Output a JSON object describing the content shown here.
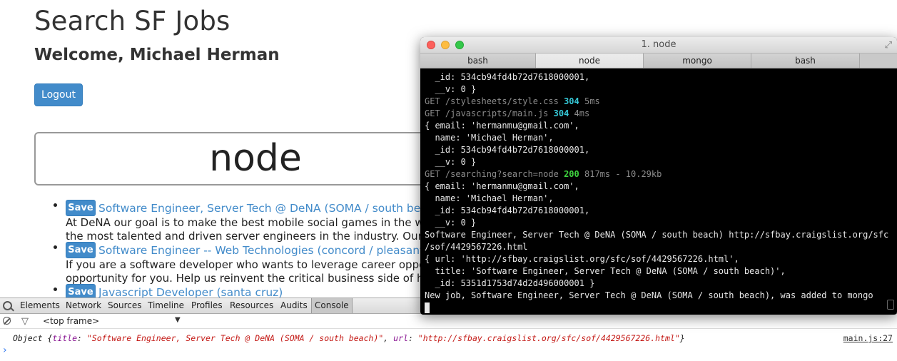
{
  "page": {
    "title": "Search SF Jobs",
    "welcome": "Welcome, Michael Herman",
    "logout_label": "Logout",
    "search_value": "node"
  },
  "jobs": [
    {
      "save_label": "Save",
      "title": "Software Engineer, Server Tech @ DeNA (SOMA / south beach)",
      "desc": [
        "At DeNA our goal is to make the best mobile social games in the wo",
        "the most talented and driven server engineers in the industry. Our s"
      ]
    },
    {
      "save_label": "Save",
      "title": "Software Engineer -- Web Technologies (concord / pleasant h",
      "desc": [
        "If you are a software developer who wants to leverage career opport",
        "opportunity for you. Help us reinvent the critical business side of he"
      ]
    },
    {
      "save_label": "Save",
      "title": "Javascript Developer (santa cruz)",
      "desc": []
    }
  ],
  "devtools": {
    "tabs": [
      "Elements",
      "Network",
      "Sources",
      "Timeline",
      "Profiles",
      "Resources",
      "Audits",
      "Console"
    ],
    "active_tab": "Console",
    "frame": "<top frame>",
    "console": {
      "prefix": "Object {",
      "title_key": "title",
      "title_value": "\"Software Engineer, Server Tech @ DeNA (SOMA / south beach)\"",
      "url_key": "url",
      "url_value": "\"http://sfbay.craigslist.org/sfc/sof/4429567226.html\"",
      "suffix": "}",
      "source": "main.js:27"
    },
    "prompt": "›"
  },
  "terminal": {
    "title": "1. node",
    "tabs": [
      "bash",
      "node",
      "mongo",
      "bash"
    ],
    "active_tab": "node",
    "lines": [
      [
        {
          "t": "  _id: 534cb94fd4b72d7618000001,"
        }
      ],
      [
        {
          "t": "  __v: 0 }"
        }
      ],
      [
        {
          "t": "GET /stylesheets/style.css ",
          "c": "dim"
        },
        {
          "t": "304",
          "c": "cyan"
        },
        {
          "t": " 5ms",
          "c": "dim"
        }
      ],
      [
        {
          "t": "GET /javascripts/main.js ",
          "c": "dim"
        },
        {
          "t": "304",
          "c": "cyan"
        },
        {
          "t": " 4ms",
          "c": "dim"
        }
      ],
      [
        {
          "t": "{ email: 'hermanmu@gmail.com',"
        }
      ],
      [
        {
          "t": "  name: 'Michael Herman',"
        }
      ],
      [
        {
          "t": "  _id: 534cb94fd4b72d7618000001,"
        }
      ],
      [
        {
          "t": "  __v: 0 }"
        }
      ],
      [
        {
          "t": "GET /searching?search=node ",
          "c": "dim"
        },
        {
          "t": "200",
          "c": "green-t"
        },
        {
          "t": " 817ms - 10.29kb",
          "c": "dim"
        }
      ],
      [
        {
          "t": "{ email: 'hermanmu@gmail.com',"
        }
      ],
      [
        {
          "t": "  name: 'Michael Herman',"
        }
      ],
      [
        {
          "t": "  _id: 534cb94fd4b72d7618000001,"
        }
      ],
      [
        {
          "t": "  __v: 0 }"
        }
      ],
      [
        {
          "t": "Software Engineer, Server Tech @ DeNA (SOMA / south beach) http://sfbay.craigslist.org/sfc"
        }
      ],
      [
        {
          "t": "/sof/4429567226.html"
        }
      ],
      [
        {
          "t": "{ url: 'http://sfbay.craigslist.org/sfc/sof/4429567226.html',"
        }
      ],
      [
        {
          "t": "  title: 'Software Engineer, Server Tech @ DeNA (SOMA / south beach)',"
        }
      ],
      [
        {
          "t": "  _id: 5351d1753d74d2d496000001 }"
        }
      ],
      [
        {
          "t": "New job, Software Engineer, Server Tech @ DeNA (SOMA / south beach), was added to mongo"
        }
      ]
    ]
  }
}
